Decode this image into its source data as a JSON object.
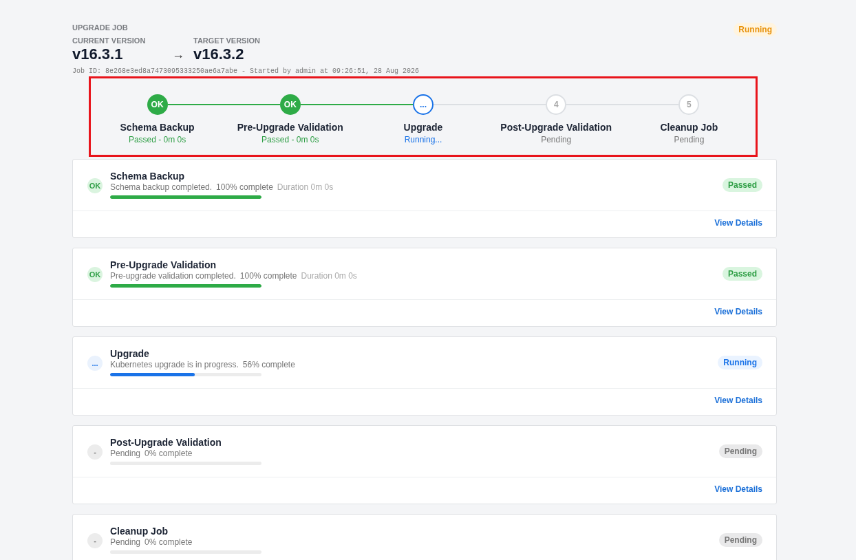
{
  "header": {
    "section_label": "UPGRADE JOB",
    "current_version_label": "CURRENT VERSION",
    "current_version": "v16.3.1",
    "arrow": "→",
    "target_version_label": "TARGET VERSION",
    "target_version": "v16.3.2",
    "job_info": "Job ID: 8e268e3ed8a7473095333250ae6a7abe - Started by admin at 09:26:51, 28 Aug 2026",
    "status": "Running"
  },
  "stepper": {
    "highlighted": true,
    "steps": [
      {
        "kind": "passed",
        "marker": "OK",
        "name": "Schema Backup",
        "subtitle": "Passed - 0m 0s"
      },
      {
        "kind": "passed",
        "marker": "OK",
        "name": "Pre-Upgrade Validation",
        "subtitle": "Passed - 0m 0s"
      },
      {
        "kind": "running",
        "marker": "...",
        "name": "Upgrade",
        "subtitle": "Running..."
      },
      {
        "kind": "pending",
        "marker": "4",
        "name": "Post-Upgrade Validation",
        "subtitle": "Pending"
      },
      {
        "kind": "pending",
        "marker": "5",
        "name": "Cleanup Job",
        "subtitle": "Pending"
      }
    ]
  },
  "cards": [
    {
      "kind": "passed",
      "marker": "OK",
      "title": "Schema Backup",
      "message": "Schema backup completed.",
      "percent": "100% complete",
      "duration": "Duration 0m 0s",
      "level": 1,
      "status": "Passed",
      "link": "View Details"
    },
    {
      "kind": "passed",
      "marker": "OK",
      "title": "Pre-Upgrade Validation",
      "message": "Pre-upgrade validation completed.",
      "percent": "100% complete",
      "duration": "Duration 0m 0s",
      "level": 1,
      "status": "Passed",
      "link": "View Details"
    },
    {
      "kind": "running",
      "marker": "...",
      "title": "Upgrade",
      "message": "Kubernetes upgrade is in progress.",
      "percent": "56% complete",
      "level": 0.56,
      "status": "Running",
      "link": "View Details"
    },
    {
      "kind": "pending",
      "marker": "-",
      "title": "Post-Upgrade Validation",
      "message": "Pending",
      "percent": "0% complete",
      "level": 0,
      "status": "Pending",
      "link": "View Details"
    },
    {
      "kind": "pending",
      "marker": "-",
      "title": "Cleanup Job",
      "message": "Pending",
      "percent": "0% complete",
      "level": 0,
      "status": "Pending"
    }
  ]
}
